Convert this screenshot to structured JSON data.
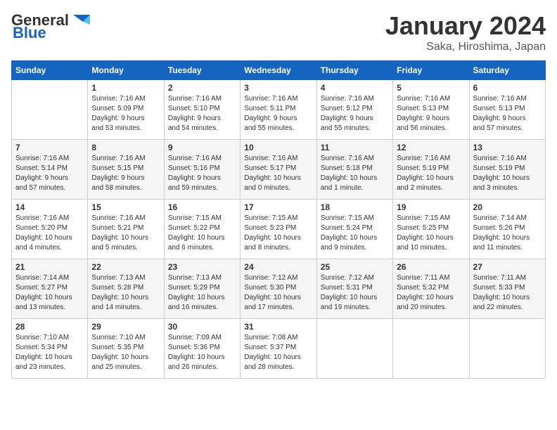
{
  "header": {
    "logo_general": "General",
    "logo_blue": "Blue",
    "month_year": "January 2024",
    "location": "Saka, Hiroshima, Japan"
  },
  "days_of_week": [
    "Sunday",
    "Monday",
    "Tuesday",
    "Wednesday",
    "Thursday",
    "Friday",
    "Saturday"
  ],
  "weeks": [
    [
      {
        "day": "",
        "info": ""
      },
      {
        "day": "1",
        "info": "Sunrise: 7:16 AM\nSunset: 5:09 PM\nDaylight: 9 hours\nand 53 minutes."
      },
      {
        "day": "2",
        "info": "Sunrise: 7:16 AM\nSunset: 5:10 PM\nDaylight: 9 hours\nand 54 minutes."
      },
      {
        "day": "3",
        "info": "Sunrise: 7:16 AM\nSunset: 5:11 PM\nDaylight: 9 hours\nand 55 minutes."
      },
      {
        "day": "4",
        "info": "Sunrise: 7:16 AM\nSunset: 5:12 PM\nDaylight: 9 hours\nand 55 minutes."
      },
      {
        "day": "5",
        "info": "Sunrise: 7:16 AM\nSunset: 5:13 PM\nDaylight: 9 hours\nand 56 minutes."
      },
      {
        "day": "6",
        "info": "Sunrise: 7:16 AM\nSunset: 5:13 PM\nDaylight: 9 hours\nand 57 minutes."
      }
    ],
    [
      {
        "day": "7",
        "info": "Sunrise: 7:16 AM\nSunset: 5:14 PM\nDaylight: 9 hours\nand 57 minutes."
      },
      {
        "day": "8",
        "info": "Sunrise: 7:16 AM\nSunset: 5:15 PM\nDaylight: 9 hours\nand 58 minutes."
      },
      {
        "day": "9",
        "info": "Sunrise: 7:16 AM\nSunset: 5:16 PM\nDaylight: 9 hours\nand 59 minutes."
      },
      {
        "day": "10",
        "info": "Sunrise: 7:16 AM\nSunset: 5:17 PM\nDaylight: 10 hours\nand 0 minutes."
      },
      {
        "day": "11",
        "info": "Sunrise: 7:16 AM\nSunset: 5:18 PM\nDaylight: 10 hours\nand 1 minute."
      },
      {
        "day": "12",
        "info": "Sunrise: 7:16 AM\nSunset: 5:19 PM\nDaylight: 10 hours\nand 2 minutes."
      },
      {
        "day": "13",
        "info": "Sunrise: 7:16 AM\nSunset: 5:19 PM\nDaylight: 10 hours\nand 3 minutes."
      }
    ],
    [
      {
        "day": "14",
        "info": "Sunrise: 7:16 AM\nSunset: 5:20 PM\nDaylight: 10 hours\nand 4 minutes."
      },
      {
        "day": "15",
        "info": "Sunrise: 7:16 AM\nSunset: 5:21 PM\nDaylight: 10 hours\nand 5 minutes."
      },
      {
        "day": "16",
        "info": "Sunrise: 7:15 AM\nSunset: 5:22 PM\nDaylight: 10 hours\nand 6 minutes."
      },
      {
        "day": "17",
        "info": "Sunrise: 7:15 AM\nSunset: 5:23 PM\nDaylight: 10 hours\nand 8 minutes."
      },
      {
        "day": "18",
        "info": "Sunrise: 7:15 AM\nSunset: 5:24 PM\nDaylight: 10 hours\nand 9 minutes."
      },
      {
        "day": "19",
        "info": "Sunrise: 7:15 AM\nSunset: 5:25 PM\nDaylight: 10 hours\nand 10 minutes."
      },
      {
        "day": "20",
        "info": "Sunrise: 7:14 AM\nSunset: 5:26 PM\nDaylight: 10 hours\nand 11 minutes."
      }
    ],
    [
      {
        "day": "21",
        "info": "Sunrise: 7:14 AM\nSunset: 5:27 PM\nDaylight: 10 hours\nand 13 minutes."
      },
      {
        "day": "22",
        "info": "Sunrise: 7:13 AM\nSunset: 5:28 PM\nDaylight: 10 hours\nand 14 minutes."
      },
      {
        "day": "23",
        "info": "Sunrise: 7:13 AM\nSunset: 5:29 PM\nDaylight: 10 hours\nand 16 minutes."
      },
      {
        "day": "24",
        "info": "Sunrise: 7:12 AM\nSunset: 5:30 PM\nDaylight: 10 hours\nand 17 minutes."
      },
      {
        "day": "25",
        "info": "Sunrise: 7:12 AM\nSunset: 5:31 PM\nDaylight: 10 hours\nand 19 minutes."
      },
      {
        "day": "26",
        "info": "Sunrise: 7:11 AM\nSunset: 5:32 PM\nDaylight: 10 hours\nand 20 minutes."
      },
      {
        "day": "27",
        "info": "Sunrise: 7:11 AM\nSunset: 5:33 PM\nDaylight: 10 hours\nand 22 minutes."
      }
    ],
    [
      {
        "day": "28",
        "info": "Sunrise: 7:10 AM\nSunset: 5:34 PM\nDaylight: 10 hours\nand 23 minutes."
      },
      {
        "day": "29",
        "info": "Sunrise: 7:10 AM\nSunset: 5:35 PM\nDaylight: 10 hours\nand 25 minutes."
      },
      {
        "day": "30",
        "info": "Sunrise: 7:09 AM\nSunset: 5:36 PM\nDaylight: 10 hours\nand 26 minutes."
      },
      {
        "day": "31",
        "info": "Sunrise: 7:08 AM\nSunset: 5:37 PM\nDaylight: 10 hours\nand 28 minutes."
      },
      {
        "day": "",
        "info": ""
      },
      {
        "day": "",
        "info": ""
      },
      {
        "day": "",
        "info": ""
      }
    ]
  ]
}
